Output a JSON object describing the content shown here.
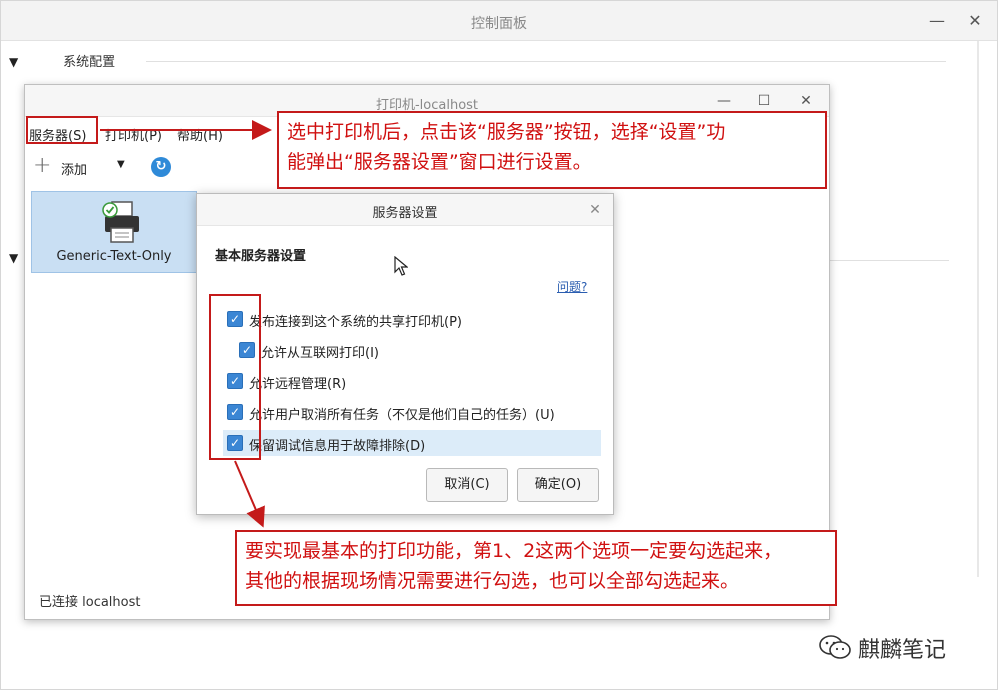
{
  "control_panel": {
    "title": "控制面板",
    "section_label": "系统配置",
    "minimize_glyph": "—",
    "close_glyph": "✕"
  },
  "printer_window": {
    "title": "打印机-localhost",
    "menu": [
      "服务器(S)",
      "打印机(P)",
      "帮助(H)"
    ],
    "toolbar": {
      "add_label": "添加"
    },
    "printers": [
      {
        "name": "Generic-Text-Only"
      }
    ],
    "status": "已连接 localhost"
  },
  "server_dialog": {
    "title": "服务器设置",
    "heading": "基本服务器设置",
    "help_link": "问题?",
    "options": [
      {
        "label": "发布连接到这个系统的共享打印机(P)",
        "checked": true
      },
      {
        "label": "允许从互联网打印(I)",
        "checked": true
      },
      {
        "label": "允许远程管理(R)",
        "checked": true
      },
      {
        "label": "允许用户取消所有任务（不仅是他们自己的任务）(U)",
        "checked": true
      },
      {
        "label": "保留调试信息用于故障排除(D)",
        "checked": true
      }
    ],
    "cancel_label": "取消(C)",
    "ok_label": "确定(O)"
  },
  "annotations": {
    "top_note_line1": "选中打印机后，点击该“服务器”按钮，选择“设置”功",
    "top_note_line2": "能弹出“服务器设置”窗口进行设置。",
    "bottom_note_line1": "要实现最基本的打印功能，第1、2这两个选项一定要勾选起来，",
    "bottom_note_line2": "其他的根据现场情况需要进行勾选，也可以全部勾选起来。"
  },
  "watermark": {
    "text": "麒麟笔记"
  },
  "colors": {
    "annotation": "#c41a1a",
    "checkbox": "#3b86d4",
    "selection": "#c9dff3"
  }
}
